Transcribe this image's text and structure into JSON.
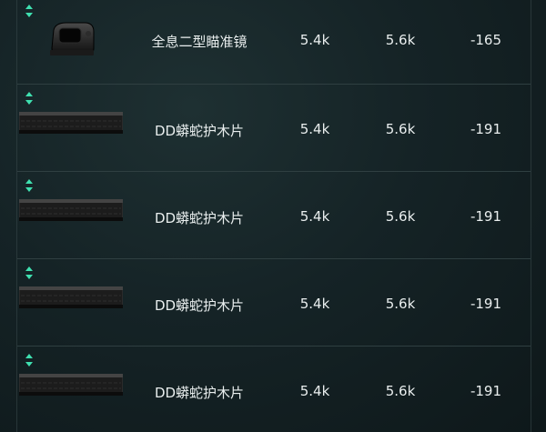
{
  "rows": [
    {
      "icon": "red-dot-sight-icon",
      "name": "全息二型瞄准镜",
      "price": "5.4k",
      "price2": "5.6k",
      "diff": "-165"
    },
    {
      "icon": "handguard-rail-icon",
      "name": "DD蟒蛇护木片",
      "price": "5.4k",
      "price2": "5.6k",
      "diff": "-191"
    },
    {
      "icon": "handguard-rail-icon",
      "name": "DD蟒蛇护木片",
      "price": "5.4k",
      "price2": "5.6k",
      "diff": "-191"
    },
    {
      "icon": "handguard-rail-icon",
      "name": "DD蟒蛇护木片",
      "price": "5.4k",
      "price2": "5.6k",
      "diff": "-191"
    },
    {
      "icon": "handguard-rail-icon",
      "name": "DD蟒蛇护木片",
      "price": "5.4k",
      "price2": "5.6k",
      "diff": "-191"
    }
  ],
  "colors": {
    "swap_icon": "#3fe0b0",
    "text": "#e9eeee",
    "divider": "#2f3f41"
  }
}
